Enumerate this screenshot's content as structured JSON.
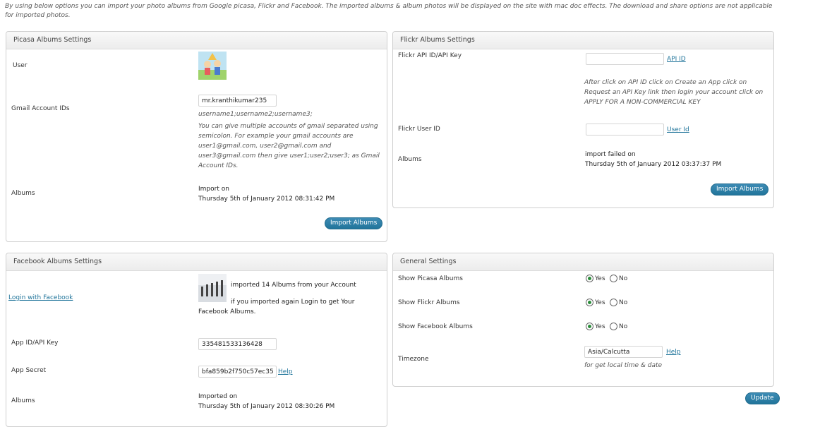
{
  "intro_text": "By using below options you can import your photo albums from Google picasa, Flickr and Facebook. The imported albums & album photos will be displayed on the site with mac doc effects. The download and share options are not applicable for imported photos.",
  "picasa": {
    "title": "Picasa Albums Settings",
    "user_label": "User",
    "gmail_label": "Gmail Account IDs",
    "gmail_value": "mr.kranthikumar235",
    "gmail_hint": "username1;username2;username3;",
    "gmail_help": "You can give multiple accounts of gmail separated using semicolon. For example your gmail accounts are user1@gmail.com, user2@gmail.com and user3@gmail.com then give user1;user2;user3; as Gmail Account IDs.",
    "albums_label": "Albums",
    "import_status": "Import on",
    "import_date": "Thursday 5th of January 2012 08:31:42 PM",
    "import_button": "Import Albums"
  },
  "flickr": {
    "title": "Flickr Albums Settings",
    "api_label": "Flickr API ID/API Key",
    "api_value": "",
    "api_link": "API ID",
    "api_help": "After click on API ID click on Create an App click on Request an API Key link then login your account click on APPLY FOR A NON-COMMERCIAL KEY",
    "user_label": "Flickr User ID",
    "user_value": "",
    "user_link": "User Id",
    "albums_label": "Albums",
    "import_status": "import failed on",
    "import_date": "Thursday 5th of January 2012 03:37:37 PM",
    "import_button": "Import Albums"
  },
  "facebook": {
    "title": "Facebook Albums Settings",
    "login_link": "Login with Facebook",
    "imported_text": "imported 14 Albums from your Account",
    "reimport_hint": "if you imported again Login to get Your Facebook Albums.",
    "app_id_label": "App ID/API Key",
    "app_id_value": "335481533136428",
    "secret_label": "App Secret",
    "secret_value": "bfa859b2f750c57ec35",
    "secret_link": "Help",
    "albums_label": "Albums",
    "import_status": "Imported on",
    "import_date": "Thursday 5th of January 2012 08:30:26 PM"
  },
  "general": {
    "title": "General Settings",
    "show_picasa_label": "Show Picasa Albums",
    "show_flickr_label": "Show Flickr Albums",
    "show_facebook_label": "Show Facebook Albums",
    "yes": "Yes",
    "no": "No",
    "timezone_label": "Timezone",
    "timezone_value": "Asia/Calcutta",
    "timezone_link": "Help",
    "timezone_hint": "for get local time & date",
    "update_button": "Update"
  },
  "colors": {
    "accent": "#21759b",
    "radio_on": "#2a8c3a"
  }
}
